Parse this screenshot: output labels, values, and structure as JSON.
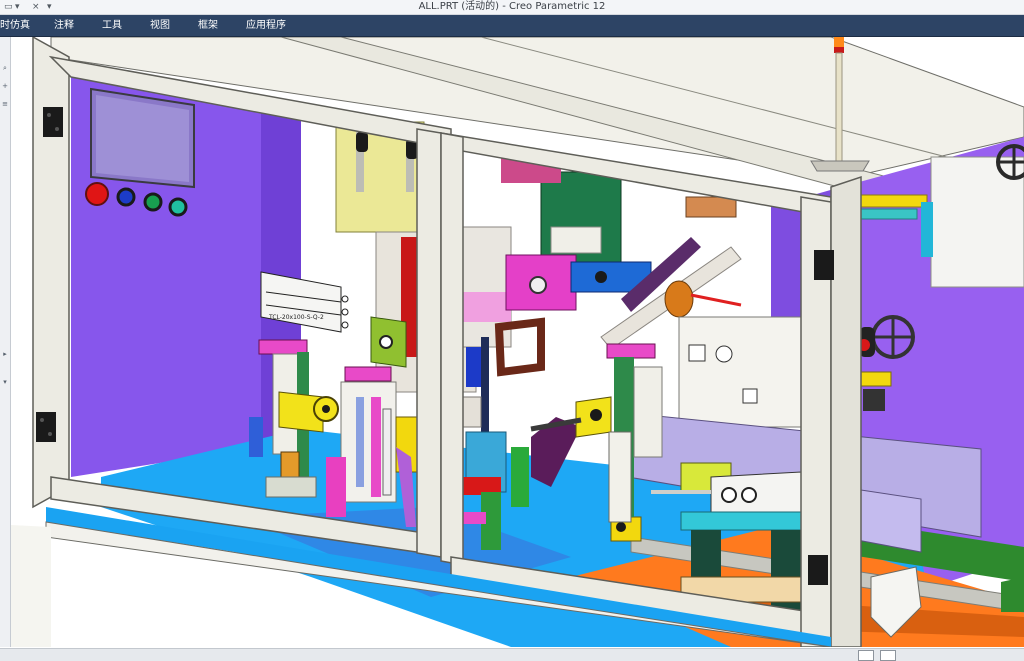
{
  "window": {
    "title": "ALL.PRT (活动的) - Creo Parametric 12"
  },
  "quick_access": [
    {
      "name": "window-icon",
      "glyph": "▭"
    },
    {
      "name": "dropdown-arrow-icon",
      "glyph": "▾"
    },
    {
      "name": "close-window-icon",
      "glyph": "×"
    },
    {
      "name": "customize-toolbar-icon",
      "glyph": "▾"
    }
  ],
  "menu": [
    {
      "label": "时仿真"
    },
    {
      "label": "注释"
    },
    {
      "label": "工具"
    },
    {
      "label": "视图"
    },
    {
      "label": "框架"
    },
    {
      "label": "应用程序"
    }
  ],
  "colors": {
    "menubar": "#2d4465",
    "frame": "#ecebe3",
    "purple_panel": "#8a5ee8",
    "base_blue": "#1aa3f2",
    "conveyor_orange": "#ff7a1e",
    "rail_green": "#2e8a2e",
    "yellow_part": "#f2e21a",
    "magenta_part": "#e040c0",
    "red_button": "#e01515",
    "slider_lavender": "#b8aee6"
  },
  "model_labels": {
    "cylinder_tag": "TCL-20x100-S-Q-2"
  }
}
